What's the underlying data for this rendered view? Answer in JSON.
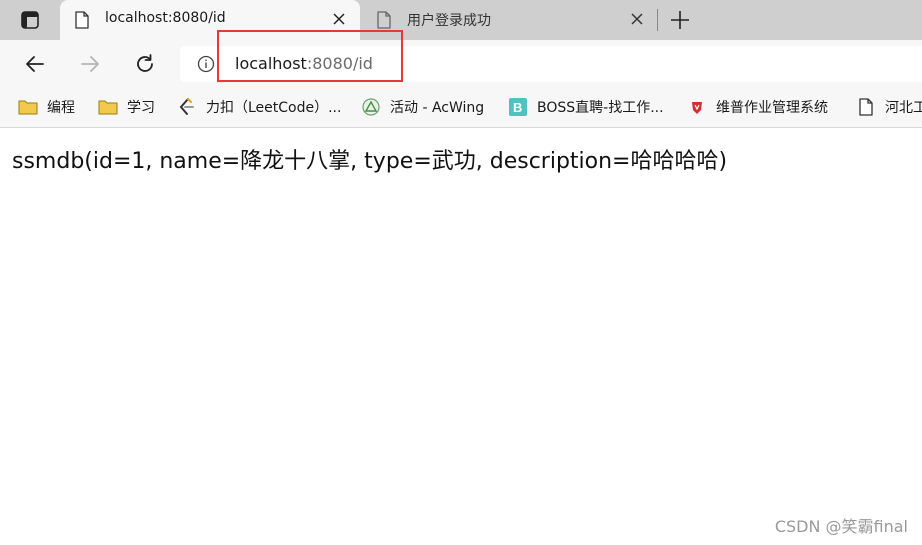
{
  "tabs": [
    {
      "title": "localhost:8080/id",
      "active": true
    },
    {
      "title": "用户登录成功",
      "active": false
    }
  ],
  "address_bar": {
    "host": "localhost",
    "path": ":8080/id"
  },
  "bookmarks": [
    {
      "label": "编程",
      "icon": "folder-icon"
    },
    {
      "label": "学习",
      "icon": "folder-icon"
    },
    {
      "label": "力扣（LeetCode）...",
      "icon": "leetcode-icon"
    },
    {
      "label": "活动 - AcWing",
      "icon": "acwing-icon"
    },
    {
      "label": "BOSS直聘-找工作...",
      "icon": "boss-icon"
    },
    {
      "label": "维普作业管理系统",
      "icon": "vip-icon"
    },
    {
      "label": "河北工",
      "icon": "page-icon"
    }
  ],
  "page": {
    "body_text": "ssmdb(id=1, name=降龙十八掌, type=武功, description=哈哈哈哈)"
  },
  "watermark": "CSDN @笑霸final",
  "colors": {
    "tab_strip": "#cfcfcf",
    "toolbar": "#f7f7f7",
    "highlight": "#e53935",
    "folder": "#f2c94c"
  }
}
